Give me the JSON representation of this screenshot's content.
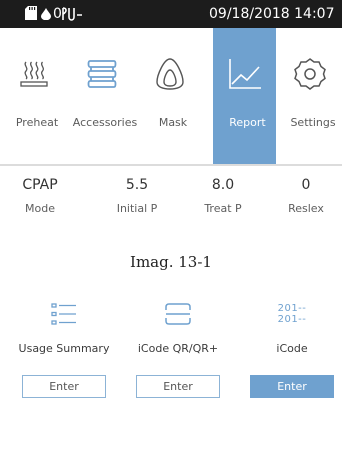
{
  "status_bar": {
    "zero_text": "0",
    "datetime": "09/18/2018 14:07"
  },
  "tabs": [
    {
      "label": "Preheat",
      "icon": "heater-icon",
      "active": false
    },
    {
      "label": "Accessories",
      "icon": "accessories-icon",
      "active": false
    },
    {
      "label": "Mask",
      "icon": "mask-icon",
      "active": false
    },
    {
      "label": "Report",
      "icon": "chart-line-icon",
      "active": true
    },
    {
      "label": "Settings",
      "icon": "gear-icon",
      "active": false
    }
  ],
  "parameters": [
    {
      "value": "CPAP",
      "label": "Mode"
    },
    {
      "value": "5.5",
      "label": "Initial P"
    },
    {
      "value": "8.0",
      "label": "Treat P"
    },
    {
      "value": "0",
      "label": "Reslex"
    }
  ],
  "caption": "Imag. 13-1",
  "functions": [
    {
      "label": "Usage Summary",
      "icon": "list-icon",
      "button": "Enter",
      "active": false
    },
    {
      "label": "iCode QR/QR+",
      "icon": "qr-frame-icon",
      "button": "Enter",
      "active": false
    },
    {
      "label": "iCode",
      "icon": "icode-icon",
      "icon_text": [
        "201--",
        "201--"
      ],
      "button": "Enter",
      "active": true
    }
  ],
  "colors": {
    "accent": "#6fa1cf",
    "status_bar": "#1c1c1c",
    "divider": "#dcdcdc"
  }
}
